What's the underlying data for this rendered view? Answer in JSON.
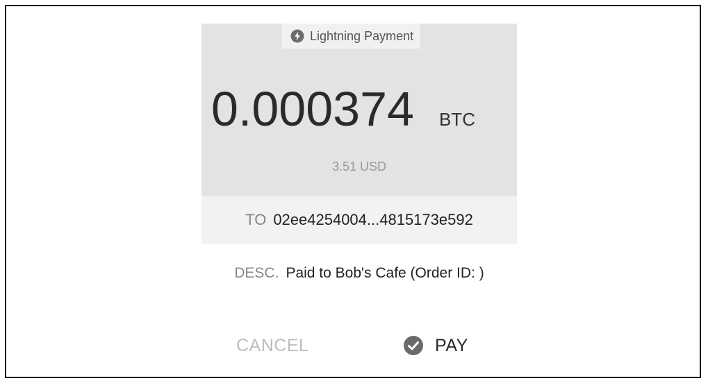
{
  "header": {
    "badge_label": "Lightning Payment",
    "badge_icon": "lightning-bolt-icon"
  },
  "amount": {
    "value": "0.000374",
    "unit": "BTC",
    "fiat": "3.51 USD"
  },
  "recipient": {
    "label": "TO",
    "value": "02ee4254004...4815173e592"
  },
  "description": {
    "label": "DESC.",
    "value": "Paid to Bob's Cafe (Order ID: )"
  },
  "actions": {
    "cancel_label": "CANCEL",
    "pay_label": "PAY",
    "pay_icon": "check-circle-icon"
  },
  "colors": {
    "panel_bg": "#e3e3e3",
    "row_bg": "#f2f2f2",
    "muted_text": "#888888",
    "disabled_text": "#bdbdbd"
  }
}
